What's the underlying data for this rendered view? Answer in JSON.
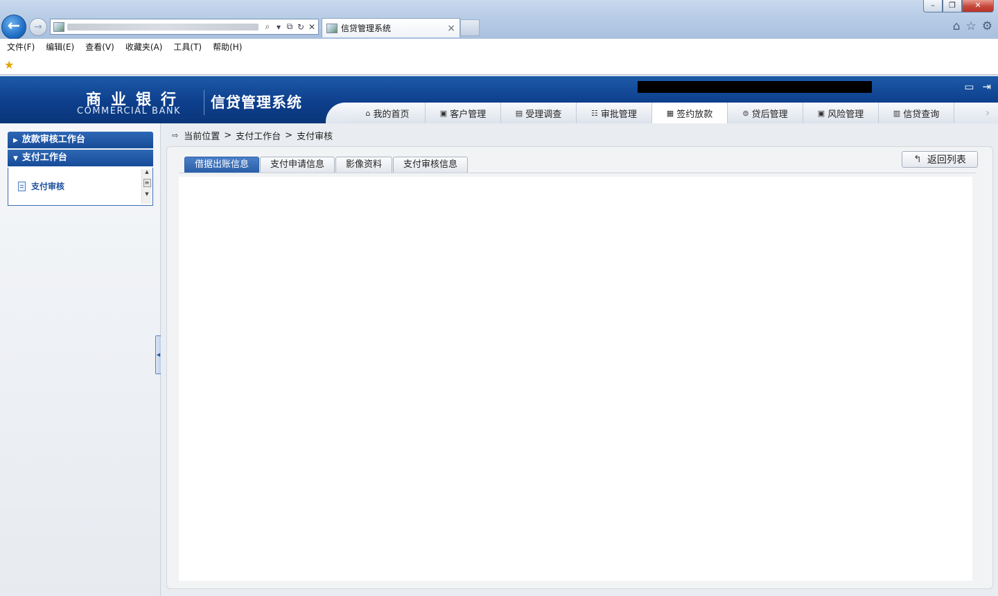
{
  "browser": {
    "tab_title": "信贷管理系统",
    "tab_close": "×",
    "window_controls": {
      "minimize": "–",
      "restore": "❐",
      "close": "✕"
    },
    "address_icons": {
      "search": "⌕",
      "dropdown": "▾",
      "compat": "⧉",
      "refresh": "↻",
      "stop": "✕"
    },
    "toolbar_icons": {
      "home": "⌂",
      "favorites": "☆",
      "tools": "⚙"
    }
  },
  "menubar": {
    "items": [
      "文件(F)",
      "编辑(E)",
      "查看(V)",
      "收藏夹(A)",
      "工具(T)",
      "帮助(H)"
    ]
  },
  "header": {
    "logo_cn": "商业银行",
    "logo_en": "COMMERCIAL BANK",
    "system_title": "信贷管理系统"
  },
  "nav": {
    "tabs": [
      {
        "label": "我的首页",
        "icon": "home-icon"
      },
      {
        "label": "客户管理",
        "icon": "customer-icon"
      },
      {
        "label": "受理调查",
        "icon": "survey-icon"
      },
      {
        "label": "审批管理",
        "icon": "approval-icon"
      },
      {
        "label": "签约放款",
        "icon": "contract-icon",
        "active": true
      },
      {
        "label": "贷后管理",
        "icon": "post-loan-icon"
      },
      {
        "label": "风险管理",
        "icon": "risk-icon"
      },
      {
        "label": "信贷查询",
        "icon": "query-icon"
      }
    ],
    "more_icon": "›"
  },
  "sidebar": {
    "sections": [
      {
        "label": "放款审核工作台",
        "expanded": false
      },
      {
        "label": "支付工作台",
        "expanded": true,
        "items": [
          "支付审核"
        ]
      }
    ]
  },
  "breadcrumb": {
    "prefix": "当前位置",
    "items": [
      "支付工作台",
      "支付审核"
    ],
    "separator": ">"
  },
  "detail": {
    "tabs": [
      "借据出账信息",
      "支付申请信息",
      "影像资料",
      "支付审核信息"
    ],
    "active_tab": 0,
    "back_button": "返回列表"
  },
  "colors": {
    "header_blue": "#0d3f8c",
    "active_tab_blue": "#2a5ea8"
  }
}
